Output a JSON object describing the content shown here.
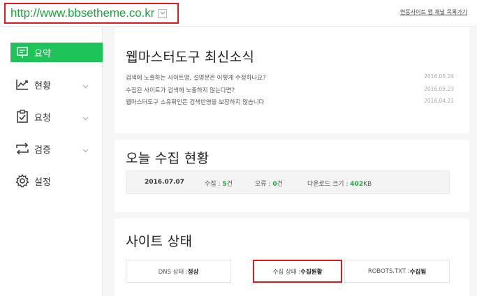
{
  "header": {
    "url": "http://www.bbsetheme.co.kr",
    "link": "연동사이트 앱 채널 목록가기"
  },
  "sidebar": {
    "items": [
      {
        "label": "요약",
        "icon": "summary-board-icon",
        "active": true
      },
      {
        "label": "현황",
        "icon": "trend-chart-icon",
        "active": false
      },
      {
        "label": "요청",
        "icon": "clipboard-check-icon",
        "active": false
      },
      {
        "label": "검증",
        "icon": "verify-arrows-icon",
        "active": false
      },
      {
        "label": "설정",
        "icon": "gear-icon",
        "active": false
      }
    ]
  },
  "news": {
    "title": "웹마스터도구 최신소식",
    "items": [
      {
        "text": "검색에 노출하는 사이트명, 설명문은 어떻게 수정하나요?",
        "date": "2016.05.24"
      },
      {
        "text": "수집된 사이트가 검색에 노출하지 않는다면?",
        "date": "2016.05.23"
      },
      {
        "text": "웹마스터도구 소유확인은 검색반영을 보장하지 않습니다",
        "date": "2016.04.21"
      }
    ]
  },
  "today": {
    "title": "오늘 수집 현황",
    "date": "2016.07.07",
    "collect_label": "수집 : ",
    "collect_value": "5",
    "collect_unit": "건",
    "error_label": "오류 : ",
    "error_value": "0",
    "error_unit": "건",
    "download_label": "다운로드 크기 : ",
    "download_value": "402",
    "download_unit": "KB"
  },
  "site": {
    "title": "사이트 상태",
    "dns_label": "DNS 상태 : ",
    "dns_value": "정상",
    "collect_label": "수집 상태 : ",
    "collect_value": "수집원활",
    "robots_label": "ROBOTS.TXT : ",
    "robots_value": "수집됨"
  },
  "colors": {
    "accent_green": "#1ec35a",
    "url_green": "#1aa63a",
    "highlight_red": "#e1191f"
  }
}
